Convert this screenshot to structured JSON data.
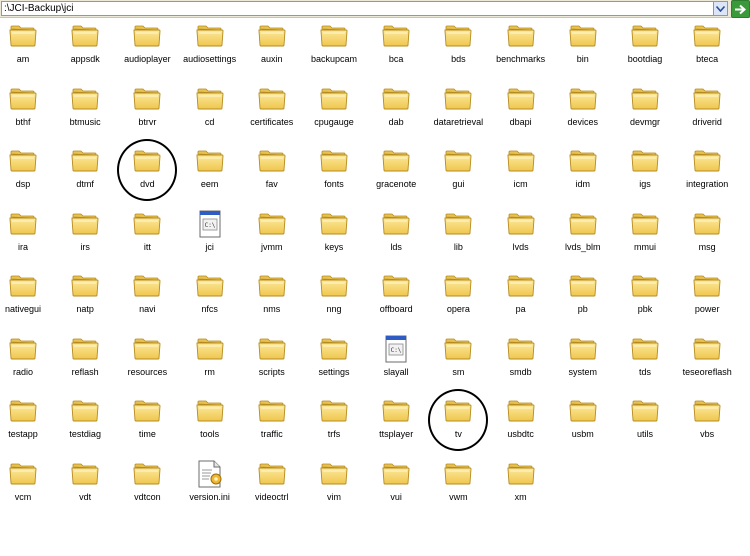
{
  "address_bar": {
    "path": ":\\JCI-Backup\\jci",
    "dropdown_icon": "chevron-down-icon",
    "go_icon": "go-arrow-icon"
  },
  "colors": {
    "folder_fill": "#f5d56b",
    "folder_tab": "#e8c150",
    "folder_edge": "#b58b20",
    "annotation": "#000000",
    "go_button": "#3a9a3a"
  },
  "items": [
    {
      "label": "am",
      "type": "folder"
    },
    {
      "label": "appsdk",
      "type": "folder"
    },
    {
      "label": "audioplayer",
      "type": "folder"
    },
    {
      "label": "audiosettings",
      "type": "folder"
    },
    {
      "label": "auxin",
      "type": "folder"
    },
    {
      "label": "backupcam",
      "type": "folder"
    },
    {
      "label": "bca",
      "type": "folder"
    },
    {
      "label": "bds",
      "type": "folder"
    },
    {
      "label": "benchmarks",
      "type": "folder"
    },
    {
      "label": "bin",
      "type": "folder"
    },
    {
      "label": "bootdiag",
      "type": "folder"
    },
    {
      "label": "bteca",
      "type": "folder"
    },
    {
      "label": "bthf",
      "type": "folder"
    },
    {
      "label": "btmusic",
      "type": "folder"
    },
    {
      "label": "btrvr",
      "type": "folder"
    },
    {
      "label": "cd",
      "type": "folder"
    },
    {
      "label": "certificates",
      "type": "folder"
    },
    {
      "label": "cpugauge",
      "type": "folder"
    },
    {
      "label": "dab",
      "type": "folder"
    },
    {
      "label": "dataretrieval",
      "type": "folder"
    },
    {
      "label": "dbapi",
      "type": "folder"
    },
    {
      "label": "devices",
      "type": "folder"
    },
    {
      "label": "devmgr",
      "type": "folder"
    },
    {
      "label": "driverid",
      "type": "folder"
    },
    {
      "label": "dsp",
      "type": "folder"
    },
    {
      "label": "dtmf",
      "type": "folder"
    },
    {
      "label": "dvd",
      "type": "folder",
      "circled": true
    },
    {
      "label": "eem",
      "type": "folder"
    },
    {
      "label": "fav",
      "type": "folder"
    },
    {
      "label": "fonts",
      "type": "folder"
    },
    {
      "label": "gracenote",
      "type": "folder"
    },
    {
      "label": "gui",
      "type": "folder"
    },
    {
      "label": "icm",
      "type": "folder"
    },
    {
      "label": "idm",
      "type": "folder"
    },
    {
      "label": "igs",
      "type": "folder"
    },
    {
      "label": "integration",
      "type": "folder"
    },
    {
      "label": "ira",
      "type": "folder"
    },
    {
      "label": "irs",
      "type": "folder"
    },
    {
      "label": "itt",
      "type": "folder"
    },
    {
      "label": "jci",
      "type": "script"
    },
    {
      "label": "jvmm",
      "type": "folder"
    },
    {
      "label": "keys",
      "type": "folder"
    },
    {
      "label": "lds",
      "type": "folder"
    },
    {
      "label": "lib",
      "type": "folder"
    },
    {
      "label": "lvds",
      "type": "folder"
    },
    {
      "label": "lvds_blm",
      "type": "folder"
    },
    {
      "label": "mmui",
      "type": "folder"
    },
    {
      "label": "msg",
      "type": "folder"
    },
    {
      "label": "nativegui",
      "type": "folder"
    },
    {
      "label": "natp",
      "type": "folder"
    },
    {
      "label": "navi",
      "type": "folder"
    },
    {
      "label": "nfcs",
      "type": "folder"
    },
    {
      "label": "nms",
      "type": "folder"
    },
    {
      "label": "nng",
      "type": "folder"
    },
    {
      "label": "offboard",
      "type": "folder"
    },
    {
      "label": "opera",
      "type": "folder"
    },
    {
      "label": "pa",
      "type": "folder"
    },
    {
      "label": "pb",
      "type": "folder"
    },
    {
      "label": "pbk",
      "type": "folder"
    },
    {
      "label": "power",
      "type": "folder"
    },
    {
      "label": "radio",
      "type": "folder"
    },
    {
      "label": "reflash",
      "type": "folder"
    },
    {
      "label": "resources",
      "type": "folder"
    },
    {
      "label": "rm",
      "type": "folder"
    },
    {
      "label": "scripts",
      "type": "folder"
    },
    {
      "label": "settings",
      "type": "folder"
    },
    {
      "label": "slayall",
      "type": "script"
    },
    {
      "label": "sm",
      "type": "folder"
    },
    {
      "label": "smdb",
      "type": "folder"
    },
    {
      "label": "system",
      "type": "folder"
    },
    {
      "label": "tds",
      "type": "folder"
    },
    {
      "label": "teseoreflash",
      "type": "folder"
    },
    {
      "label": "testapp",
      "type": "folder"
    },
    {
      "label": "testdiag",
      "type": "folder"
    },
    {
      "label": "time",
      "type": "folder"
    },
    {
      "label": "tools",
      "type": "folder"
    },
    {
      "label": "traffic",
      "type": "folder"
    },
    {
      "label": "trfs",
      "type": "folder"
    },
    {
      "label": "ttsplayer",
      "type": "folder"
    },
    {
      "label": "tv",
      "type": "folder",
      "circled": true
    },
    {
      "label": "usbdtc",
      "type": "folder"
    },
    {
      "label": "usbm",
      "type": "folder"
    },
    {
      "label": "utils",
      "type": "folder"
    },
    {
      "label": "vbs",
      "type": "folder"
    },
    {
      "label": "vcm",
      "type": "folder"
    },
    {
      "label": "vdt",
      "type": "folder"
    },
    {
      "label": "vdtcon",
      "type": "folder"
    },
    {
      "label": "version.ini",
      "type": "ini"
    },
    {
      "label": "videoctrl",
      "type": "folder"
    },
    {
      "label": "vim",
      "type": "folder"
    },
    {
      "label": "vui",
      "type": "folder"
    },
    {
      "label": "vwm",
      "type": "folder"
    },
    {
      "label": "xm",
      "type": "folder"
    }
  ]
}
